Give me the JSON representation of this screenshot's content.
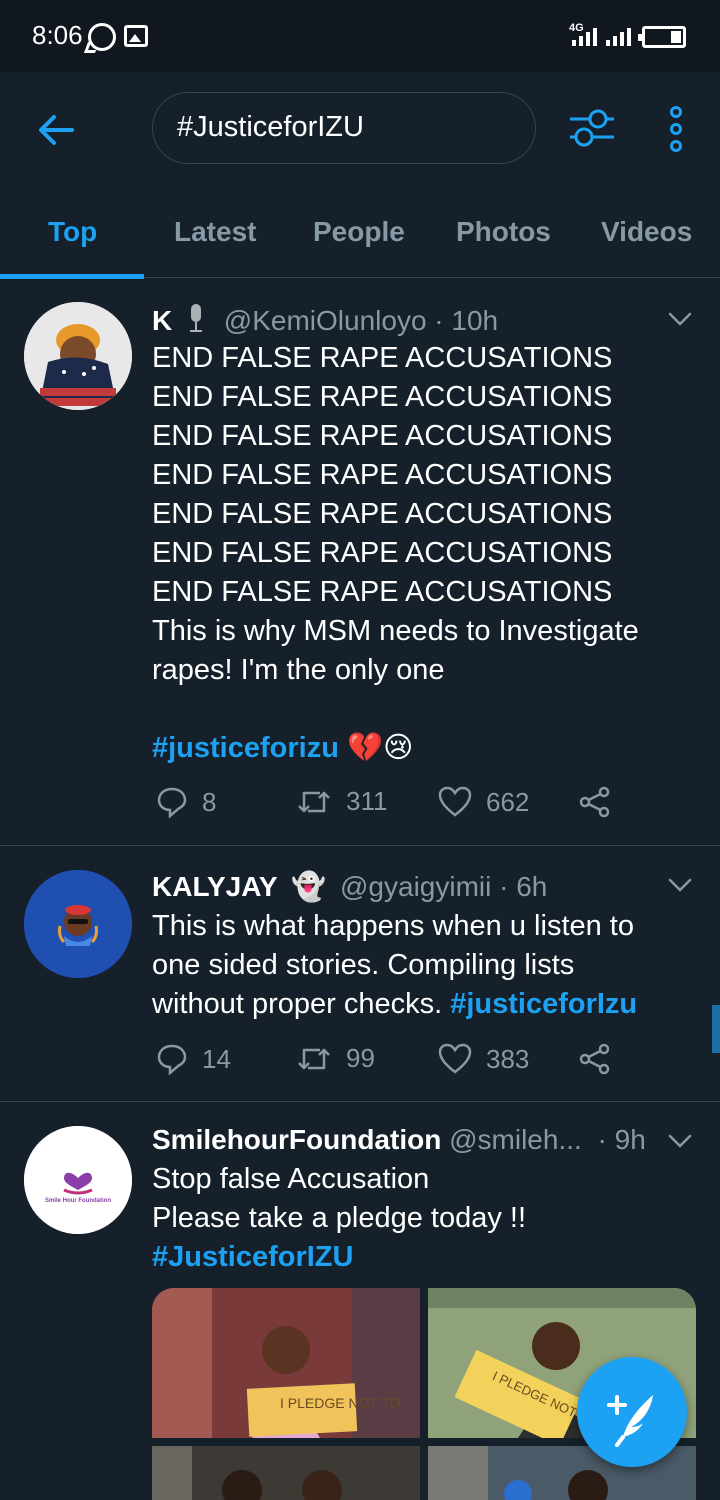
{
  "status_bar": {
    "time": "8:06",
    "network": "4G"
  },
  "search": {
    "query": "#JusticeforIZU"
  },
  "tabs": [
    {
      "label": "Top",
      "active": true
    },
    {
      "label": "Latest",
      "active": false
    },
    {
      "label": "People",
      "active": false
    },
    {
      "label": "Photos",
      "active": false
    },
    {
      "label": "Videos",
      "active": false
    }
  ],
  "tweets": [
    {
      "name": "K",
      "handle": "@KemiOlunloyo · 10h",
      "lines": [
        "END FALSE RAPE ACCUSATIONS",
        "END FALSE RAPE ACCUSATIONS",
        "END FALSE RAPE ACCUSATIONS",
        "END FALSE RAPE ACCUSATIONS",
        "END FALSE RAPE ACCUSATIONS",
        "END FALSE RAPE ACCUSATIONS",
        "END FALSE RAPE ACCUSATIONS",
        "This is why MSM needs to Investigate",
        "rapes! I'm the only one"
      ],
      "hashtag": "#justiceforizu",
      "emoji": "💔😢",
      "replies": "8",
      "retweets": "311",
      "likes": "662"
    },
    {
      "name": "KALYJAY",
      "name_emoji": "👻",
      "handle": "@gyaigyimii · 6h",
      "lines": [
        "This is what happens when u listen to",
        "one sided stories. Compiling lists",
        "without proper checks."
      ],
      "hashtag": "#justiceforIzu",
      "replies": "14",
      "retweets": "99",
      "likes": "383"
    },
    {
      "name": "SmilehourFoundation",
      "handle": "@smileh...",
      "time": "· 9h",
      "lines": [
        "Stop false Accusation",
        "Please take a pledge today !!"
      ],
      "hashtag": "#JusticeforIZU",
      "avatar_logo_text": "Smile Hour Foundation",
      "media_text": [
        "I PLEDGE NOT TO",
        "I PLEDGE NOT TO"
      ]
    }
  ],
  "colors": {
    "background": "#15202b",
    "accent": "#1da1f2",
    "muted": "#8899a6",
    "border": "#38444d"
  },
  "icons": [
    "whatsapp-icon",
    "gallery-icon",
    "back-arrow-icon",
    "filter-icon",
    "more-vertical-icon",
    "chevron-down-icon",
    "reply-icon",
    "retweet-icon",
    "like-icon",
    "share-icon",
    "compose-icon"
  ]
}
